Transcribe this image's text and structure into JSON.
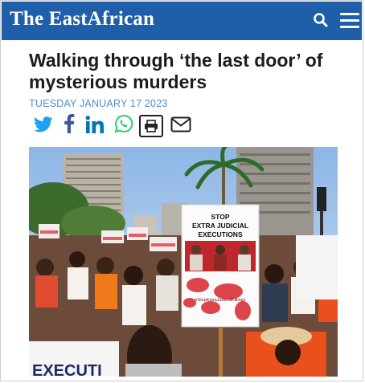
{
  "header": {
    "site_name": "The EastAfrican",
    "brand_color": "#1f5fa9",
    "search_icon": "search-icon",
    "menu_icon": "hamburger-menu-icon"
  },
  "article": {
    "title": "Walking through ‘the last door’ of mysterious murders",
    "date": "TUESDAY JANUARY 17 2023"
  },
  "share": {
    "items": [
      {
        "icon": "twitter-icon",
        "color": "#1da1f2"
      },
      {
        "icon": "facebook-icon",
        "color": "#3b5998"
      },
      {
        "icon": "linkedin-icon",
        "color": "#0077b5"
      },
      {
        "icon": "whatsapp-icon",
        "color": "#25d366"
      },
      {
        "icon": "print-icon",
        "color": "#222222"
      },
      {
        "icon": "email-icon",
        "color": "#222222"
      }
    ]
  },
  "photo": {
    "placard_line1": "STOP",
    "placard_line2": "EXTRA JUDICIAL",
    "placard_line3": "EXECUTIONS",
    "placard_hashtag": "#StopExtraJudicialKillings",
    "banner_fragment": "EXECUTI"
  }
}
